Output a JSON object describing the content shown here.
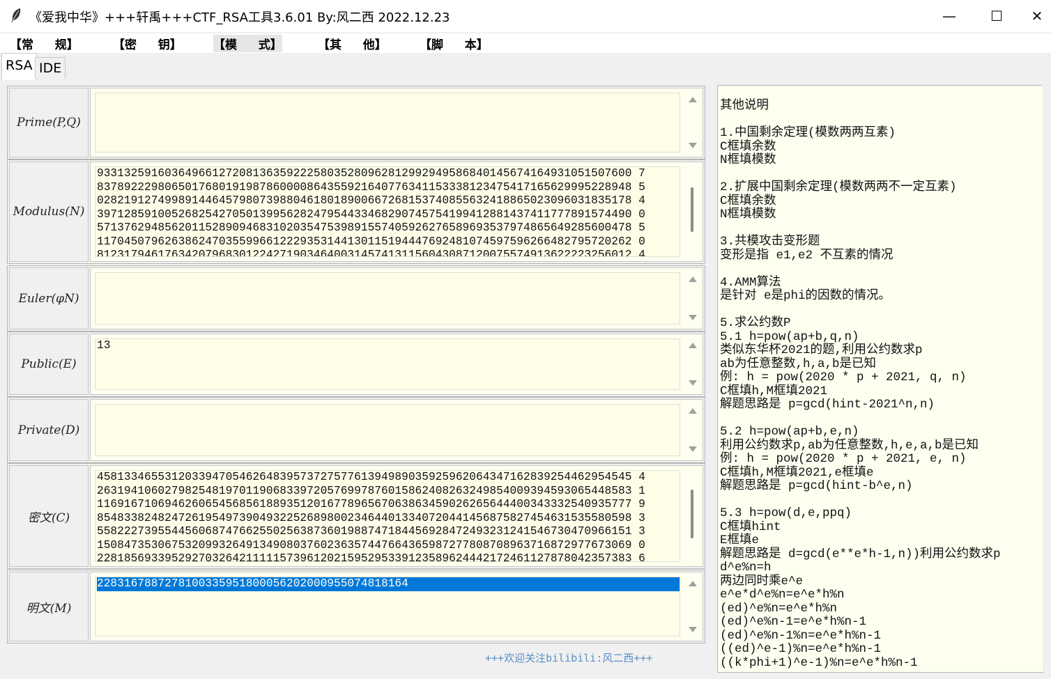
{
  "window": {
    "title": "《爱我中华》+++轩禹+++CTF_RSA工具3.6.01   By:风二西 2022.12.23",
    "minimize": "—",
    "maximize": "☐",
    "close": "✕"
  },
  "menu": [
    "【常   规】",
    "【密   钥】",
    "【模   式】",
    "【其   他】",
    "【脚   本】"
  ],
  "tabs": [
    "RSA",
    "IDE"
  ],
  "fields": {
    "prime": {
      "label": "Prime(P,Q)",
      "value": ""
    },
    "modulus": {
      "label": "Modulus(N)",
      "value": "9331325916036496612720813635922258035280962812992949586840145674164931051507600 7\n8378922298065017680191987860000864355921640776341153338123475417165629995228948 5\n0282191274998914464579807398804618018900667268153740855632418865023096031835178 4\n3971285910052682542705013995628247954433468290745754199412881437411777891574490 0\n5713762948562011528909468310203547539891557405926276589693537974865649285600478 5\n1170450796263862470355996612229353144130115194447692481074597596266482795720262 0\n8123179461763420796830122427190346400314574131156043087120075574913622223256012 4"
    },
    "euler": {
      "label": "Euler(φN)",
      "value": ""
    },
    "public": {
      "label": "Public(E)",
      "value": "13"
    },
    "private": {
      "label": "Private(D)",
      "value": ""
    },
    "cipher": {
      "label": "密文(C)",
      "value": "4581334655312033947054626483957372757761394989035925962064347162839254462954545 4\n2631941060279825481970119068339720576997876015862408263249854009394593065448583 1\n1169167106946260654568561889351201677896567063863459026265644400343332540935777 9\n8548338248247261954973904932252689800234644013340720441456875827454631535580598 3\n5582227395544560687476625502563873601988747184456928472493231241546730470966151 3\n1508473530675320993264913490803760236357447664365987277808708963716872977673069 0\n2281856933952927032642111115739612021595295339123589624442172461127878042357383 6"
    },
    "plain": {
      "label": "明文(M)",
      "value": "2283167887278100335951800056202000955074818164"
    }
  },
  "footer_note": "+++欢迎关注bilibili:风二西+++",
  "notes": "其他说明\n\n1.中国剩余定理(模数两两互素)\nC框填余数\nN框填模数\n\n2.扩展中国剩余定理(模数两两不一定互素)\nC框填余数\nN框填模数\n\n3.共模攻击变形题\n变形是指 e1,e2 不互素的情况\n\n4.AMM算法\n是针对 e是phi的因数的情况。\n\n5.求公约数P\n5.1 h=pow(ap+b,q,n)\n类似东华杯2021的题,利用公约数求p\nab为任意整数,h,a,b是已知\n例: h = pow(2020 * p + 2021, q, n)\nC框填h,M框填2021\n解题思路是 p=gcd(hint-2021^n,n)\n\n5.2 h=pow(ap+b,e,n)\n利用公约数求p,ab为任意整数,h,e,a,b是已知\n例: h = pow(2020 * p + 2021, e, n)\nC框填h,M框填2021,e框填e\n解题思路是 p=gcd(hint-b^e,n)\n\n5.3 h=pow(d,e,ppq)\nC框填hint\nE框填e\n解题思路是 d=gcd(e**e*h-1,n))利用公约数求p\nd^e%n=h\n两边同时乘e^e\ne^e*d^e%n=e^e*h%n\n(ed)^e%n=e^e*h%n\n(ed)^e%n-1=e^e*h%n-1\n(ed)^e%n-1%n=e^e*h%n-1\n((ed)^e-1)%n=e^e*h%n-1\n((k*phi+1)^e-1)%n=e^e*h%n-1",
  "colors": {
    "field_bg": "#fffff0",
    "selection": "#0078d7",
    "footer": "#5a8fc8"
  }
}
